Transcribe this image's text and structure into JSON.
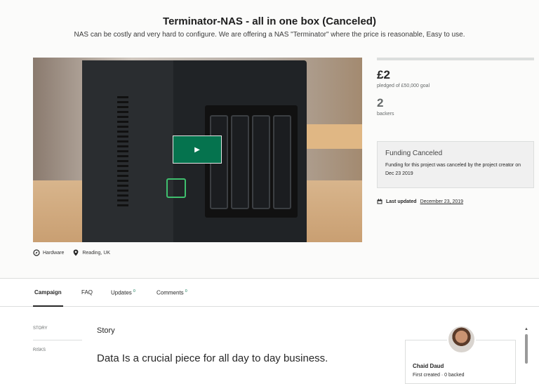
{
  "project": {
    "title": "Terminator-NAS - all in one box (Canceled)",
    "blurb": "NAS can be costly and very hard to configure. We are offering a NAS \"Terminator\" where the price is reasonable, Easy to use."
  },
  "video": {
    "play_icon": "play-icon",
    "play_label": "▶"
  },
  "tags": {
    "category_icon": "compass-icon",
    "category": "Hardware",
    "location_icon": "map-pin-icon",
    "location": "Reading, UK"
  },
  "stats": {
    "pledged": "£2",
    "pledged_label": "pledged of £50,000 goal",
    "backers": "2",
    "backers_label": "backers"
  },
  "status": {
    "heading": "Funding Canceled",
    "body": "Funding for this project was canceled by the project creator on Dec 23 2019"
  },
  "updated": {
    "icon": "calendar-icon",
    "label": "Last updated",
    "date": "December 23, 2019"
  },
  "tabs": [
    {
      "label": "Campaign",
      "count": ""
    },
    {
      "label": "FAQ",
      "count": ""
    },
    {
      "label": "Updates",
      "count": "0"
    },
    {
      "label": "Comments",
      "count": "0"
    }
  ],
  "sidenav": {
    "story": "STORY",
    "risks": "RISKS"
  },
  "story": {
    "heading": "Story",
    "lead": "Data Is a crucial piece for all day to day business."
  },
  "creator": {
    "name": "Chaid Daud",
    "meta": "First created · 0 backed"
  },
  "colors": {
    "accent": "#05734e",
    "text": "#282828",
    "muted": "#656969"
  }
}
